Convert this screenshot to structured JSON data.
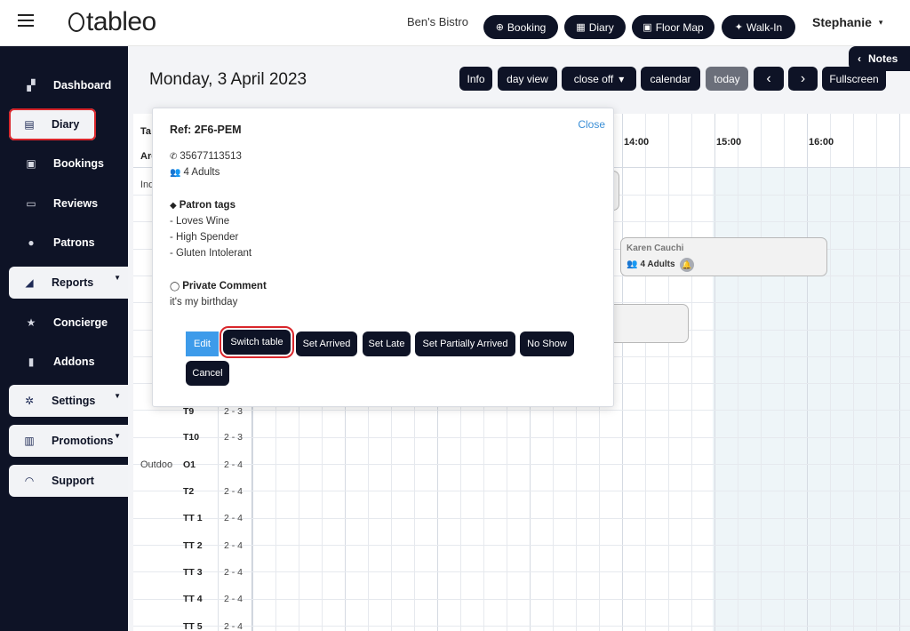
{
  "header": {
    "logo_text": "tableo",
    "venue_name": "Ben's Bistro",
    "buttons": [
      {
        "label": "Booking",
        "icon": "plus-circle-icon",
        "glyph": "⊕"
      },
      {
        "label": "Diary",
        "icon": "calendar-icon",
        "glyph": "▦"
      },
      {
        "label": "Floor Map",
        "icon": "floor-map-icon",
        "glyph": "▣"
      },
      {
        "label": "Walk-In",
        "icon": "walking-icon",
        "glyph": "🚶"
      }
    ],
    "user_name": "Stephanie",
    "user_caret": "▾"
  },
  "sidebar": {
    "items": [
      {
        "label": "Dashboard",
        "icon": "dashboard-icon",
        "glyph": "▞"
      },
      {
        "label": "Diary",
        "icon": "calendar-icon",
        "glyph": "▤"
      },
      {
        "label": "Bookings",
        "icon": "bookings-icon",
        "glyph": "▣"
      },
      {
        "label": "Reviews",
        "icon": "reviews-icon",
        "glyph": "▭"
      },
      {
        "label": "Patrons",
        "icon": "patron-icon",
        "glyph": "●"
      },
      {
        "label": "Reports",
        "icon": "chart-icon",
        "glyph": "◢"
      },
      {
        "label": "Concierge",
        "icon": "star-icon",
        "glyph": "★"
      },
      {
        "label": "Addons",
        "icon": "addons-icon",
        "glyph": "▮"
      },
      {
        "label": "Settings",
        "icon": "gear-icon",
        "glyph": "✲"
      },
      {
        "label": "Promotions",
        "icon": "gift-icon",
        "glyph": "▥"
      },
      {
        "label": "Support",
        "icon": "headset-icon",
        "glyph": "◠"
      }
    ],
    "dropdown_glyph": "▼"
  },
  "toolbar": {
    "date": "Monday, 3 April 2023",
    "notes_label": "Notes",
    "notes_glyph": "‹",
    "info": "Info",
    "day_view": "day view",
    "close_off": "close off",
    "close_off_caret": "▾",
    "calendar": "calendar",
    "today": "today",
    "prev": "‹",
    "next": "›",
    "fullscreen": "Fullscreen"
  },
  "grid": {
    "header_table_stub": "Ta",
    "header_area_stub": "Are",
    "times": [
      "14:00",
      "15:00",
      "16:00"
    ],
    "rows": [
      {
        "area": "Ind",
        "table": "",
        "size": ""
      },
      {
        "area": "",
        "table": "T9",
        "size": "2 - 3"
      },
      {
        "area": "",
        "table": "T10",
        "size": "2 - 3"
      },
      {
        "area": "Outdoo",
        "table": "O1",
        "size": "2 - 4"
      },
      {
        "area": "",
        "table": "T2",
        "size": "2 - 4"
      },
      {
        "area": "",
        "table": "TT 1",
        "size": "2 - 4"
      },
      {
        "area": "",
        "table": "TT 2",
        "size": "2 - 4"
      },
      {
        "area": "",
        "table": "TT 3",
        "size": "2 - 4"
      },
      {
        "area": "",
        "table": "TT 4",
        "size": "2 - 4"
      },
      {
        "area": "",
        "table": "TT 5",
        "size": "2 - 4"
      }
    ],
    "bookings": [
      {
        "name": "Karen Cauchi",
        "size": "4 Adults",
        "icon": "people-icon",
        "bell_icon": "bell-icon"
      }
    ]
  },
  "popup": {
    "close": "Close",
    "ref": "Ref: 2F6-PEM",
    "phone": "35677113513",
    "phone_icon": "phone-icon",
    "guests": "4 Adults",
    "guests_icon": "people-icon",
    "tags_title": "Patron tags",
    "tags_icon": "tag-icon",
    "tags": [
      "- Loves Wine",
      "- High Spender",
      "- Gluten Intolerant"
    ],
    "comment_title": "Private Comment",
    "comment_icon": "comment-icon",
    "comment": "it's my birthday",
    "buttons": {
      "edit": "Edit",
      "switch_table": "Switch table",
      "set_arrived": "Set Arrived",
      "set_late": "Set Late",
      "set_partially_arrived": "Set Partially Arrived",
      "no_show": "No Show",
      "cancel": "Cancel"
    }
  },
  "colors": {
    "navy": "#0e1326",
    "highlight_red": "#d9262b",
    "edit_blue": "#3d9bea",
    "link_blue": "#3b8fd6"
  }
}
